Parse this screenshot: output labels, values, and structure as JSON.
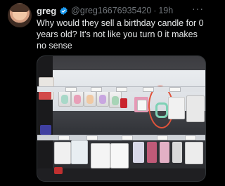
{
  "tweet": {
    "author_name": "greg",
    "author_handle": "@greg16676935420",
    "separator": "·",
    "time": "19h",
    "more_label": "···",
    "text": "Why would they sell a birthday candle for 0 years old? It's not like you turn 0 it makes no sense"
  },
  "colors": {
    "background": "#000000",
    "text_primary": "#e7e9ea",
    "text_secondary": "#71767b",
    "verified_badge": "#1d9bf0",
    "annotation_circle": "#e0533b"
  },
  "icons": {
    "verified": "verified-badge-icon",
    "more": "more-options-icon"
  }
}
